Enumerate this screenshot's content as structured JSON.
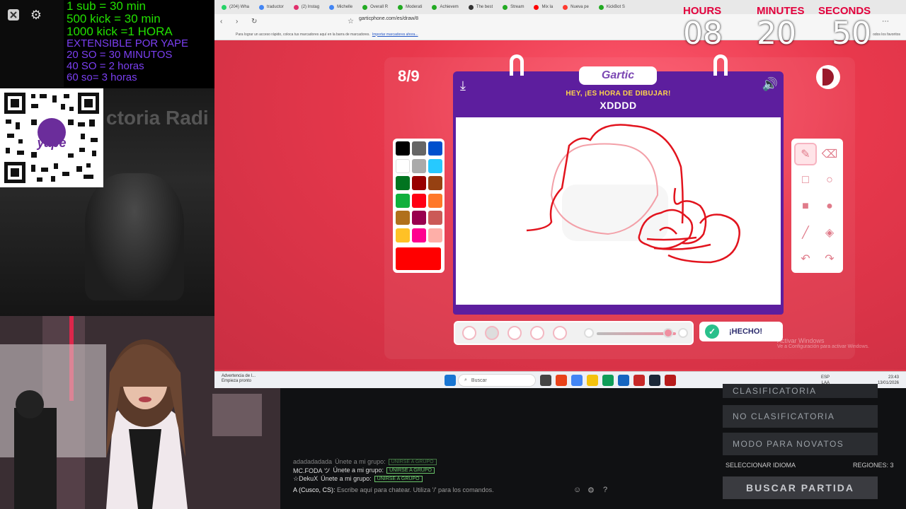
{
  "overlay": {
    "sub_lines_green": [
      "1 sub = 30 min",
      "500 kick = 30 min",
      "1000 kick =1 HORA"
    ],
    "sub_lines_purple": [
      "EXTENSIBLE POR   YAPE",
      "20 SO = 30 MINUTOS",
      "40 SO = 2 horas",
      "60 so= 3 horas"
    ],
    "qr_brand": "yape",
    "bg_text": "ctoria Radi"
  },
  "timer": {
    "hours_label": "HOURS",
    "minutes_label": "MINUTES",
    "seconds_label": "SECONDS",
    "hours": "08",
    "minutes": "20",
    "seconds": "50"
  },
  "browser": {
    "tabs": [
      {
        "label": "(204) Wha",
        "color": "#25d366"
      },
      {
        "label": "traductor",
        "color": "#4285f4"
      },
      {
        "label": "(2) Instag",
        "color": "#e1306c"
      },
      {
        "label": "Michelle",
        "color": "#4285f4"
      },
      {
        "label": "Overall R",
        "color": "#22aa22"
      },
      {
        "label": "Moderati",
        "color": "#22aa22"
      },
      {
        "label": "Achievem",
        "color": "#22aa22"
      },
      {
        "label": "The best",
        "color": "#333333"
      },
      {
        "label": "Stream",
        "color": "#22aa22"
      },
      {
        "label": "Mix la",
        "color": "#ff0000"
      },
      {
        "label": "Nueva pe",
        "color": "#ff3b30"
      },
      {
        "label": "KickBot S",
        "color": "#22aa22"
      }
    ],
    "url": "garticphone.com/es/draw/8",
    "bookmarks_text": "Para lograr un acceso rápido, coloca tus marcadores aquí en la barra de marcadores.",
    "bookmarks_link": "Importar marcadores ahora...",
    "other_favorites": "odos los favoritos"
  },
  "game": {
    "round": "8/9",
    "logo": "Gartic",
    "prompt": "HEY, ¡ES HORA DE DIBUJAR!",
    "word": "XDDDD",
    "done_label": "¡HECHO!",
    "activate_title": "Activar Windows",
    "activate_sub": "Ve a Configuración para activar Windows.",
    "palette": [
      "#000000",
      "#666666",
      "#0050cd",
      "#ffffff",
      "#aaaaaa",
      "#26c9ff",
      "#017420",
      "#990000",
      "#964112",
      "#11b03c",
      "#ff0013",
      "#ff7829",
      "#b0701c",
      "#99004e",
      "#cb5a57",
      "#ffc126",
      "#ff008f",
      "#feafa8"
    ],
    "current_color": "#ff0000",
    "tools": [
      "pencil-icon",
      "eraser-icon",
      "rect-outline-icon",
      "circle-outline-icon",
      "rect-fill-icon",
      "circle-fill-icon",
      "line-icon",
      "fill-bucket-icon",
      "undo-icon",
      "redo-icon"
    ]
  },
  "taskbar": {
    "note_title": "Advertencia de l...",
    "note_sub": "Empieza pronto",
    "search_placeholder": "Buscar",
    "lang1": "ESP",
    "lang2": "LAA",
    "time": "23:43",
    "date": "13/01/2026"
  },
  "lobby": {
    "btn_clasificatoria": "CLASIFICATORIA",
    "btn_no_clasificatoria": "NO CLASIFICATORIA",
    "btn_novatos": "MODO PARA NOVATOS",
    "idioma": "SELECCIONAR IDIOMA",
    "regiones": "REGIONES: 3",
    "buscar": "BUSCAR PARTIDA",
    "chat": [
      {
        "user": "adadadadada",
        "msg": "Únete a mi grupo:"
      },
      {
        "user": "MC.FODA ツ",
        "msg": "Únete a mi grupo:"
      },
      {
        "user": "☆DekuX",
        "msg": "Únete a mi grupo:"
      }
    ],
    "group_btn": "UNIRSE A GRUPO",
    "chat_prefix": "A (Cusco, CS):",
    "chat_placeholder": "Escribe aquí para chatear. Utiliza '/' para los comandos."
  }
}
